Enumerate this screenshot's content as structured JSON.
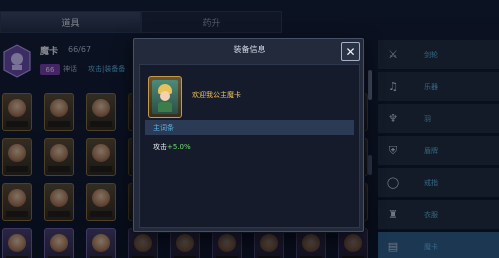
{
  "tabs": [
    {
      "label": "道具",
      "active": true
    },
    {
      "label": "药升",
      "active": false
    }
  ],
  "hero": {
    "title": "魔卡",
    "count": "66/67",
    "level": "66",
    "sub_label": "神话",
    "hint": "攻击|装备备"
  },
  "grid": {
    "rows": 4,
    "cols": 9
  },
  "side_slots": [
    {
      "icon": "sword-icon",
      "label": "剑轮",
      "active": false
    },
    {
      "icon": "lute-icon",
      "label": "乐器",
      "active": false
    },
    {
      "icon": "wing-icon",
      "label": "羽",
      "active": false
    },
    {
      "icon": "shield-icon",
      "label": "盾牌",
      "active": false
    },
    {
      "icon": "ring-icon",
      "label": "戒指",
      "active": false
    },
    {
      "icon": "armor-icon",
      "label": "衣服",
      "active": false
    },
    {
      "icon": "card-icon",
      "label": "魔卡",
      "active": true
    }
  ],
  "modal": {
    "title": "装备信息",
    "close_glyph": "✕",
    "item": {
      "name": "欢迎我公主魔卡"
    },
    "stat_header": "主词条",
    "stats": [
      {
        "label": "攻击",
        "value": "+5.0%"
      }
    ]
  },
  "colors": {
    "accent_blue": "#5fb7e6",
    "gold_text": "#f0c35a",
    "positive_green": "#6fe06a",
    "modal_bg": "#222a3c"
  }
}
